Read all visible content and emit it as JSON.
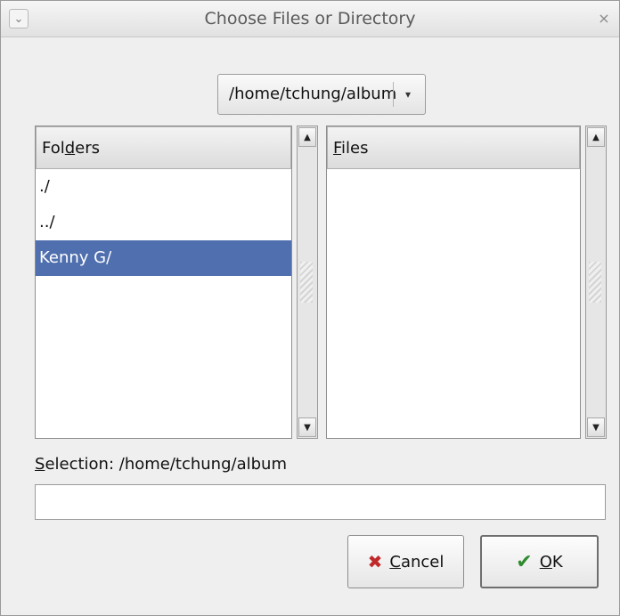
{
  "window": {
    "title": "Choose Files or Directory",
    "menu_icon": "chevron-down-icon",
    "close_icon": "close-icon",
    "close_glyph": "×",
    "menu_glyph": "⌄"
  },
  "path": {
    "value": "/home/tchung/album",
    "arrow_glyph": "▾"
  },
  "folders": {
    "header_pre": "Fol",
    "header_accel": "d",
    "header_post": "ers",
    "items": [
      "./",
      "../",
      "Kenny G/"
    ],
    "selected_index": 2
  },
  "files": {
    "header_accel": "F",
    "header_post": "iles",
    "items": []
  },
  "scrollbar": {
    "up_glyph": "▲",
    "down_glyph": "▼"
  },
  "selection": {
    "label_accel": "S",
    "label_rest": "election: /home/tchung/album",
    "input_value": ""
  },
  "buttons": {
    "cancel_accel": "C",
    "cancel_rest": "ancel",
    "cancel_icon": "cancel-icon",
    "cancel_glyph": "✖",
    "ok_accel": "O",
    "ok_rest": "K",
    "ok_icon": "checkmark-icon",
    "ok_glyph": "✔"
  },
  "colors": {
    "selection_highlight": "#4f6fae",
    "window_bg": "#efefef"
  }
}
